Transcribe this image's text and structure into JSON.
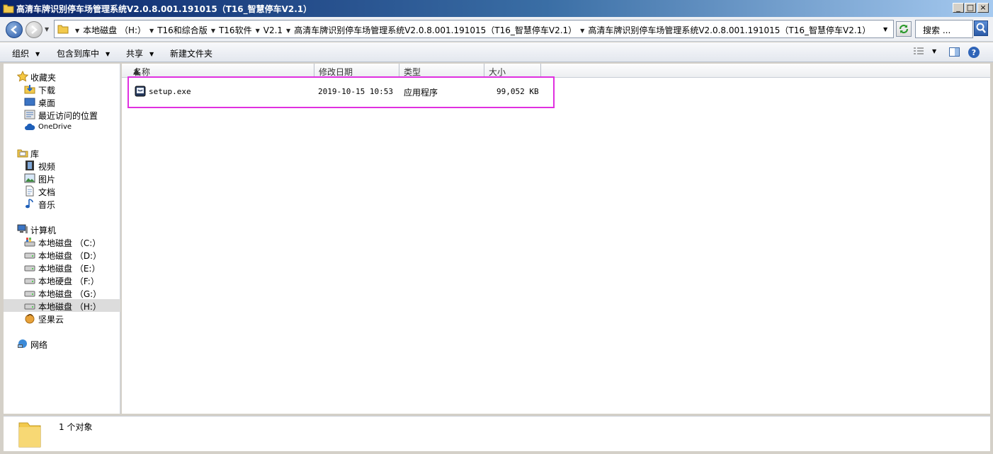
{
  "window": {
    "title": "高清车牌识别停车场管理系统V2.0.8.001.191015（T16_智慧停车V2.1）",
    "buttons": [
      "_",
      "□",
      "×"
    ]
  },
  "address": {
    "crumbs": [
      "本地磁盘 （H:）",
      "T16和综合版",
      "T16软件",
      "V2.1",
      "高清车牌识别停车场管理系统V2.0.8.001.191015（T16_智慧停车V2.1）",
      "高清车牌识别停车场管理系统V2.0.8.001.191015（T16_智慧停车V2.1）"
    ],
    "search_placeholder": "搜索 ..."
  },
  "toolbar": {
    "organize": "组织",
    "include_in_library": "包含到库中",
    "share": "共享",
    "new_folder": "新建文件夹"
  },
  "sidebar": {
    "favorites": {
      "label": "收藏夹",
      "items": [
        "下载",
        "桌面",
        "最近访问的位置",
        "OneDrive"
      ]
    },
    "libraries": {
      "label": "库",
      "items": [
        "视频",
        "图片",
        "文档",
        "音乐"
      ]
    },
    "computer": {
      "label": "计算机",
      "items": [
        "本地磁盘 （C:）",
        "本地磁盘 （D:）",
        "本地磁盘 （E:）",
        "本地硬盘 （F:）",
        "本地磁盘 （G:）",
        "本地磁盘 （H:）",
        "坚果云"
      ]
    },
    "network": {
      "label": "网络"
    }
  },
  "columns": [
    "名称",
    "修改日期",
    "类型",
    "大小"
  ],
  "files": [
    {
      "name": "setup.exe",
      "modified": "2019-10-15 10:53",
      "type": "应用程序",
      "size": "99,052 KB"
    }
  ],
  "status": {
    "count_text": "1 个对象"
  }
}
